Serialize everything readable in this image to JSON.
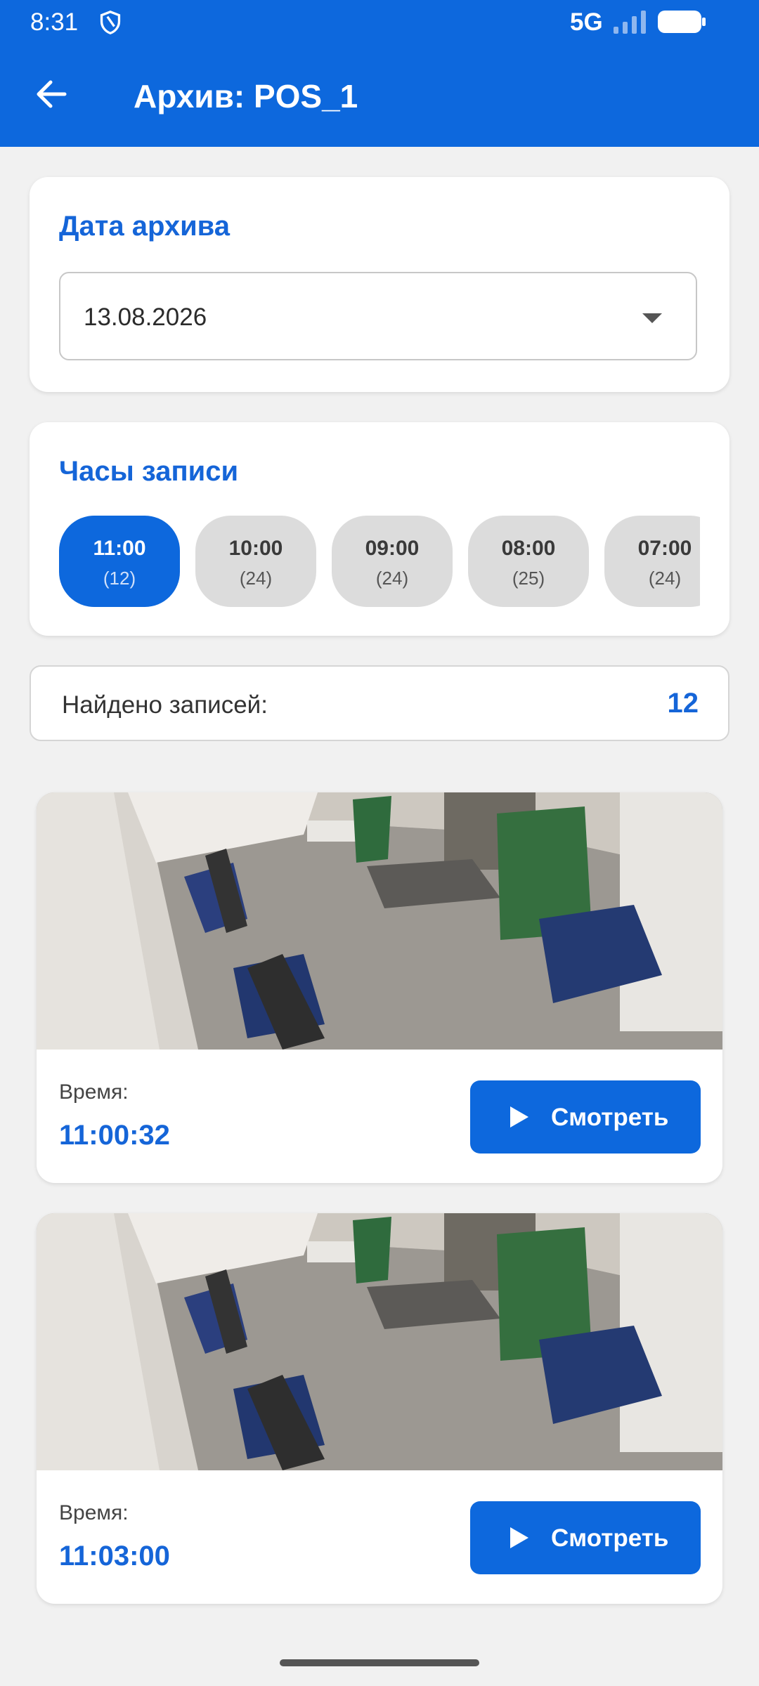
{
  "status_bar": {
    "time": "8:31",
    "network": "5G"
  },
  "app_bar": {
    "title": "Архив: POS_1"
  },
  "date_section": {
    "title": "Дата архива",
    "selected_date": "13.08.2026"
  },
  "hours_section": {
    "title": "Часы записи",
    "hours": [
      {
        "time": "11:00",
        "count": "(12)",
        "selected": true
      },
      {
        "time": "10:00",
        "count": "(24)",
        "selected": false
      },
      {
        "time": "09:00",
        "count": "(24)",
        "selected": false
      },
      {
        "time": "08:00",
        "count": "(25)",
        "selected": false
      },
      {
        "time": "07:00",
        "count": "(24)",
        "selected": false
      }
    ]
  },
  "found": {
    "label": "Найдено записей:",
    "value": "12"
  },
  "records": [
    {
      "time_label": "Время:",
      "time": "11:00:32",
      "button_label": "Смотреть"
    },
    {
      "time_label": "Время:",
      "time": "11:03:00",
      "button_label": "Смотреть"
    }
  ],
  "colors": {
    "accent": "#0d68dd",
    "accent_text": "#1565d8",
    "chip_inactive": "#dcdcdc",
    "background": "#f1f1f1"
  }
}
